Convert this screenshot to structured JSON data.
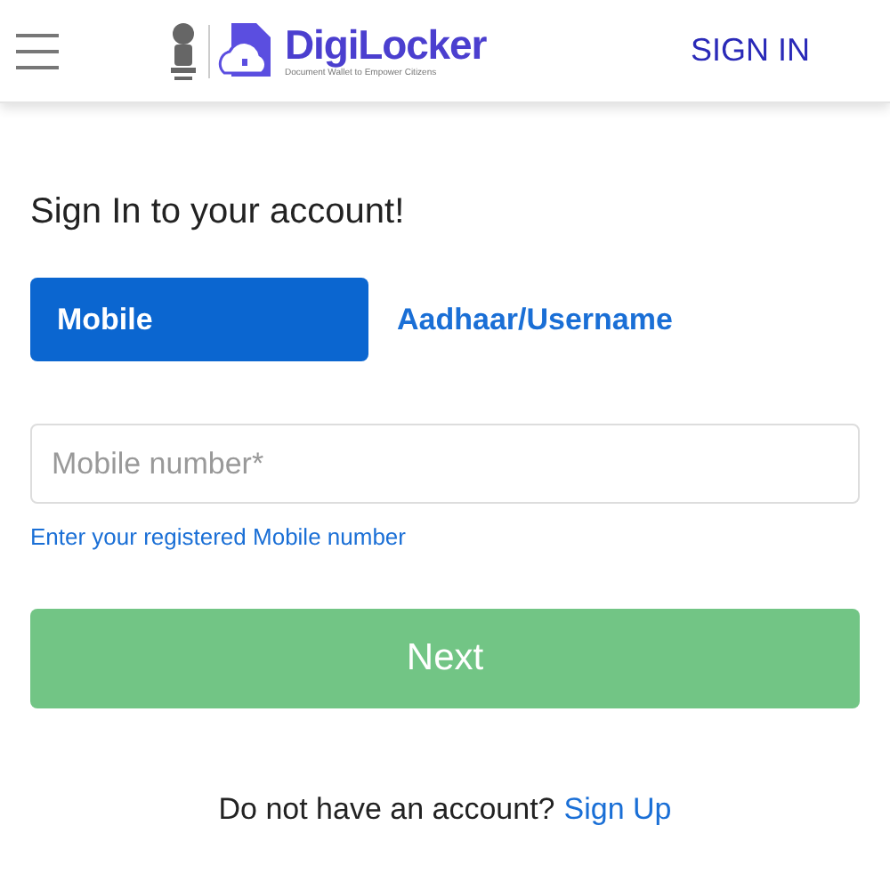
{
  "header": {
    "logo_title": "DigiLocker",
    "logo_tagline": "Document Wallet to Empower Citizens",
    "sign_in": "SIGN IN"
  },
  "heading": "Sign In to your account!",
  "tabs": [
    {
      "label": "Mobile",
      "selected": true
    },
    {
      "label": "Aadhaar/Username",
      "selected": false
    }
  ],
  "field": {
    "placeholder": "Mobile number*",
    "helper": "Enter your registered Mobile number"
  },
  "next_button": {
    "label": "Next",
    "disabled": true
  },
  "footer": {
    "text": "Do not have an account?",
    "link": "Sign Up"
  }
}
